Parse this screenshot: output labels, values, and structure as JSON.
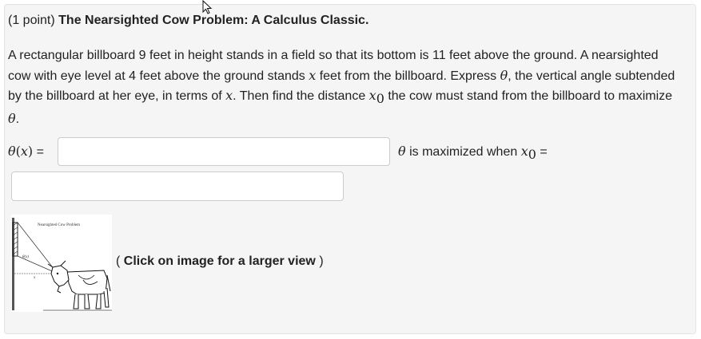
{
  "problem": {
    "points": "(1 point)",
    "title": "The Nearsighted Cow Problem: A Calculus Classic.",
    "text": {
      "p1": "A rectangular billboard 9 feet in height stands in a field so that its bottom is 11 feet above the ground. A nearsighted cow with eye level at 4 feet above the ground stands ",
      "x1": "x",
      "p2": " feet from the billboard. Express ",
      "theta1": "θ",
      "p3": ", the vertical angle subtended by the billboard at her eye, in terms of ",
      "x2": "x",
      "p4": ". Then find the distance ",
      "x0_base": "x",
      "x0_sub": "0",
      "p5": " the cow must stand from the billboard to maximize ",
      "theta2": "θ",
      "p6": "."
    }
  },
  "answer1": {
    "theta": "θ",
    "open_paren": "(",
    "var": "x",
    "close_paren": ")",
    "equals": " =",
    "value": ""
  },
  "answer2": {
    "theta": "θ",
    "text": " is maximized when ",
    "var": "x",
    "sub": "0",
    "equals": " =",
    "value": ""
  },
  "figure": {
    "caption": "Nearsighted Cow Problem",
    "angle_label": "θ(x)",
    "x_label": "x"
  },
  "enlarge_hint": {
    "open": "( ",
    "text": "Click on image for a larger view",
    "close": " )"
  },
  "icons": {
    "cursor": "mouse-pointer-icon"
  },
  "colors": {
    "panel_bg": "#f5f5f5",
    "panel_border": "#e3e3e3",
    "input_border": "#cccccc",
    "text": "#222222"
  }
}
